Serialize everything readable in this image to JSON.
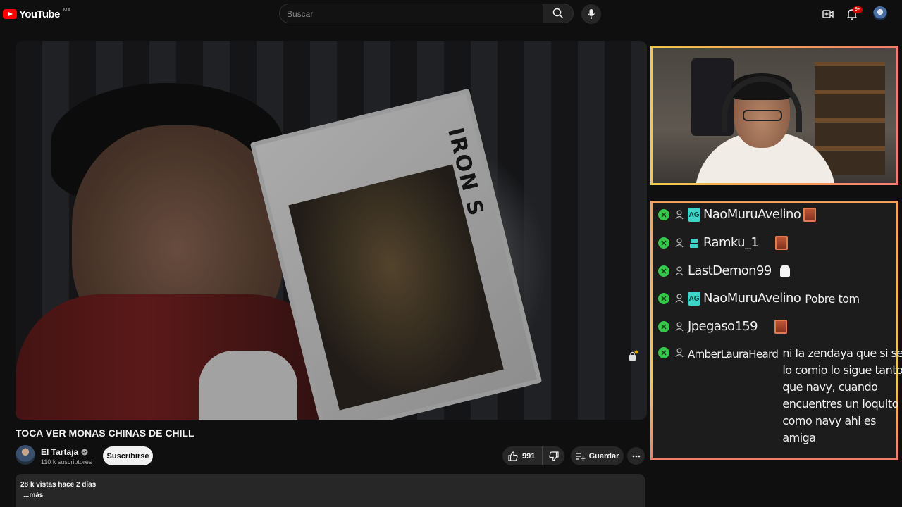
{
  "header": {
    "logo_text": "YouTube",
    "logo_country": "MX",
    "search_placeholder": "Buscar",
    "notifications_badge": "9+"
  },
  "video": {
    "box_label": "IRON S"
  },
  "info": {
    "title": "TOCA VER MONAS CHINAS DE CHILL",
    "channel_name": "El Tartaja",
    "subscribers": "110 k suscriptores",
    "subscribe_label": "Suscribirse",
    "likes": "991",
    "save_label": "Guardar",
    "desc_meta": "28 k vistas  hace 2 días",
    "desc_more": "...más"
  },
  "chat": {
    "messages": [
      {
        "badge": "AG",
        "user": "NaoMuruAvelino",
        "message": "",
        "emote": "face-emote"
      },
      {
        "badge": "",
        "user": "Ramku_1",
        "message": "",
        "emote": "face-emote"
      },
      {
        "badge": "",
        "user": "LastDemon99",
        "message": "",
        "emote": "ghost-emote"
      },
      {
        "badge": "AG",
        "user": "NaoMuruAvelino",
        "message": "Pobre tom",
        "emote": ""
      },
      {
        "badge": "",
        "user": "Jpegaso159",
        "message": "",
        "emote": "face-emote"
      },
      {
        "badge": "",
        "user": "AmberLauraHeard",
        "message": "ni la zendaya que si se lo comio lo sigue tanto que navy, cuando encuentres un loquito como navy ahi es amiga",
        "emote": ""
      }
    ]
  },
  "colors": {
    "background": "#0f0f0f",
    "frame_gradient_start": "#f2c94c",
    "frame_gradient_end": "#f27d6d",
    "chat_x_green": "#35c84a",
    "badge_teal": "#3fd4c8"
  }
}
